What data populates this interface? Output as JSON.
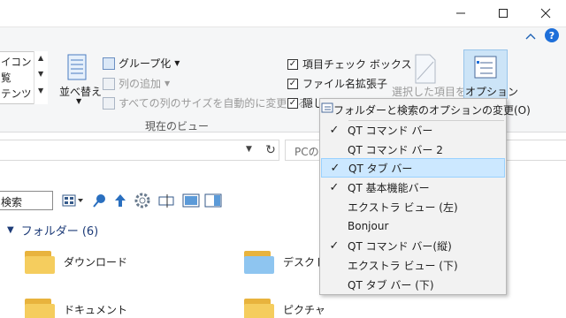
{
  "window": {
    "controls": [
      "minimize",
      "maximize",
      "close"
    ]
  },
  "ribbon": {
    "layout_items": [
      "イコン",
      "覧",
      "テンツ"
    ],
    "sort_label": "並べ替え",
    "group_by_label": "グループ化",
    "add_columns_label": "列の追加",
    "size_columns_label": "すべての列のサイズを自動的に変更する",
    "current_view_label": "現在のビュー",
    "checkboxes": [
      {
        "label": "項目チェック ボックス",
        "checked": true
      },
      {
        "label": "ファイル名拡張子",
        "checked": true
      },
      {
        "label": "隠し",
        "checked": true
      }
    ],
    "hide_selected_label": "選択した項目を",
    "options_label": "オプション"
  },
  "address": {
    "search_placeholder": "PCの検"
  },
  "toolbar": {
    "search_label": "検索"
  },
  "folders": {
    "header": "フォルダー (6)",
    "items": [
      "ダウンロード",
      "デスクトップ",
      "ドキュメント",
      "ピクチャ"
    ]
  },
  "menu": {
    "items": [
      {
        "label": "フォルダーと検索のオプションの変更(O)",
        "checked": false,
        "icon": "options-icon"
      },
      {
        "label": "QT コマンド バー",
        "checked": true
      },
      {
        "label": "QT コマンド バー 2",
        "checked": false
      },
      {
        "label": "QT タブ バー",
        "checked": true,
        "highlighted": true
      },
      {
        "label": "QT 基本機能バー",
        "checked": true
      },
      {
        "label": "エクストラ ビュー (左)",
        "checked": false
      },
      {
        "label": "Bonjour",
        "checked": false
      },
      {
        "label": "QT コマンド バー(縦)",
        "checked": true
      },
      {
        "label": "エクストラ ビュー (下)",
        "checked": false
      },
      {
        "label": "QT タブ バー (下)",
        "checked": false
      }
    ]
  },
  "colors": {
    "accent": "#1e6fd9",
    "highlight": "#cce8ff",
    "folder": "#f5cd5e"
  }
}
